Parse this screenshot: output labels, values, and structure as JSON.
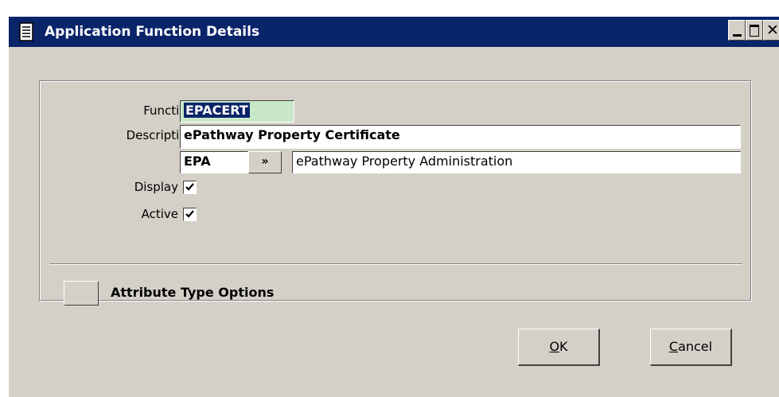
{
  "window": {
    "title": "Application Function Details",
    "title_icon": "document-icon",
    "controls": {
      "minimize": "minimize-icon",
      "maximize": "maximize-icon",
      "close": "close-icon"
    }
  },
  "form": {
    "function_label": "Function",
    "function_value": "EPACERT",
    "description_label": "Description",
    "description_value": "ePathway Property Certificate",
    "module_code": "EPA",
    "lookup_button_label": "»",
    "module_description": "ePathway Property Administration",
    "display_label": "Display",
    "display_checked": true,
    "active_label": "Active",
    "active_checked": true
  },
  "options": {
    "attribute_type_label": "Attribute Type Options"
  },
  "buttons": {
    "ok_mnemonic": "O",
    "ok_rest": "K",
    "cancel_mnemonic": "C",
    "cancel_rest": "ancel"
  },
  "colors": {
    "titlebar": "#0a246a",
    "face": "#d4d0c8",
    "selection": "#0a246a",
    "code_field_bg": "#c8e8c8"
  }
}
